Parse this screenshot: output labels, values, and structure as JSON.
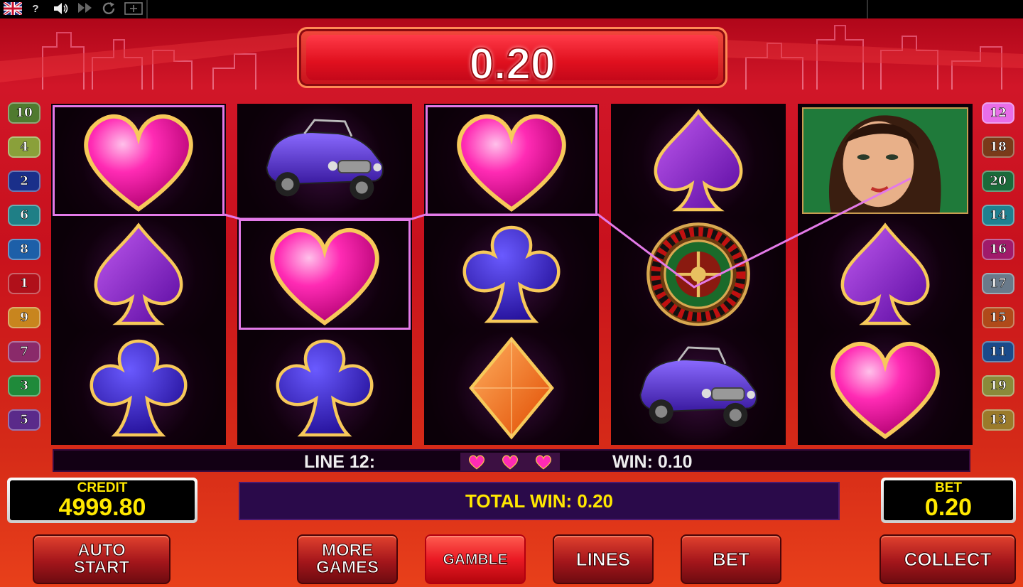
{
  "toolbar": {
    "items": [
      {
        "icon": "uk-flag-icon"
      },
      {
        "label": "?"
      },
      {
        "icon": "speaker-icon"
      },
      {
        "icon": "fast-forward-icon"
      },
      {
        "icon": "refresh-icon"
      },
      {
        "icon": "window-icon"
      }
    ]
  },
  "win_display": {
    "amount": "0.20"
  },
  "reels": [
    [
      "heart",
      "spade",
      "club"
    ],
    [
      "car",
      "heart",
      "club"
    ],
    [
      "heart",
      "club",
      "diamond"
    ],
    [
      "spade",
      "roulette",
      "car"
    ],
    [
      "woman",
      "spade",
      "heart"
    ]
  ],
  "winning_cells": [
    [
      0,
      0
    ],
    [
      1,
      1
    ],
    [
      2,
      0
    ]
  ],
  "left_lines": [
    {
      "num": "10",
      "color": "#4f7a2f"
    },
    {
      "num": "4",
      "color": "#8aa03a"
    },
    {
      "num": "2",
      "color": "#1a2f8a"
    },
    {
      "num": "6",
      "color": "#1f7f86"
    },
    {
      "num": "8",
      "color": "#1d5fa8"
    },
    {
      "num": "1",
      "color": "#b0101a"
    },
    {
      "num": "9",
      "color": "#c8851e"
    },
    {
      "num": "7",
      "color": "#8a2a6a"
    },
    {
      "num": "3",
      "color": "#1f8a3a"
    },
    {
      "num": "5",
      "color": "#5a2a8a"
    }
  ],
  "right_lines": [
    {
      "num": "12",
      "color": "#e86ee8"
    },
    {
      "num": "18",
      "color": "#7a3a1a"
    },
    {
      "num": "20",
      "color": "#1a6a3a"
    },
    {
      "num": "14",
      "color": "#1f8090"
    },
    {
      "num": "16",
      "color": "#a01a6a"
    },
    {
      "num": "17",
      "color": "#6a7a8a"
    },
    {
      "num": "15",
      "color": "#b04a1a"
    },
    {
      "num": "11",
      "color": "#1a4a8a"
    },
    {
      "num": "19",
      "color": "#8a8a3a"
    },
    {
      "num": "13",
      "color": "#9a7a2a"
    }
  ],
  "info_bar": {
    "line_label": "LINE 12:",
    "win_label": "WIN: 0.10",
    "symbol_icon": "heart-icon"
  },
  "credit": {
    "label": "CREDIT",
    "value": "4999.80"
  },
  "bet": {
    "label": "BET",
    "value": "0.20"
  },
  "total_win": {
    "label": "TOTAL WIN: 0.20"
  },
  "buttons": {
    "auto_start_1": "AUTO",
    "auto_start_2": "START",
    "more_games_1": "MORE",
    "more_games_2": "GAMES",
    "gamble": "GAMBLE",
    "lines": "LINES",
    "bet": "BET",
    "collect": "COLLECT"
  },
  "colors": {
    "heart": "#ff2bb4",
    "spade": "#8a1ec8",
    "club": "#3a1bd0",
    "diamond": "#ff6a1a",
    "winline": "#e37ae8"
  }
}
